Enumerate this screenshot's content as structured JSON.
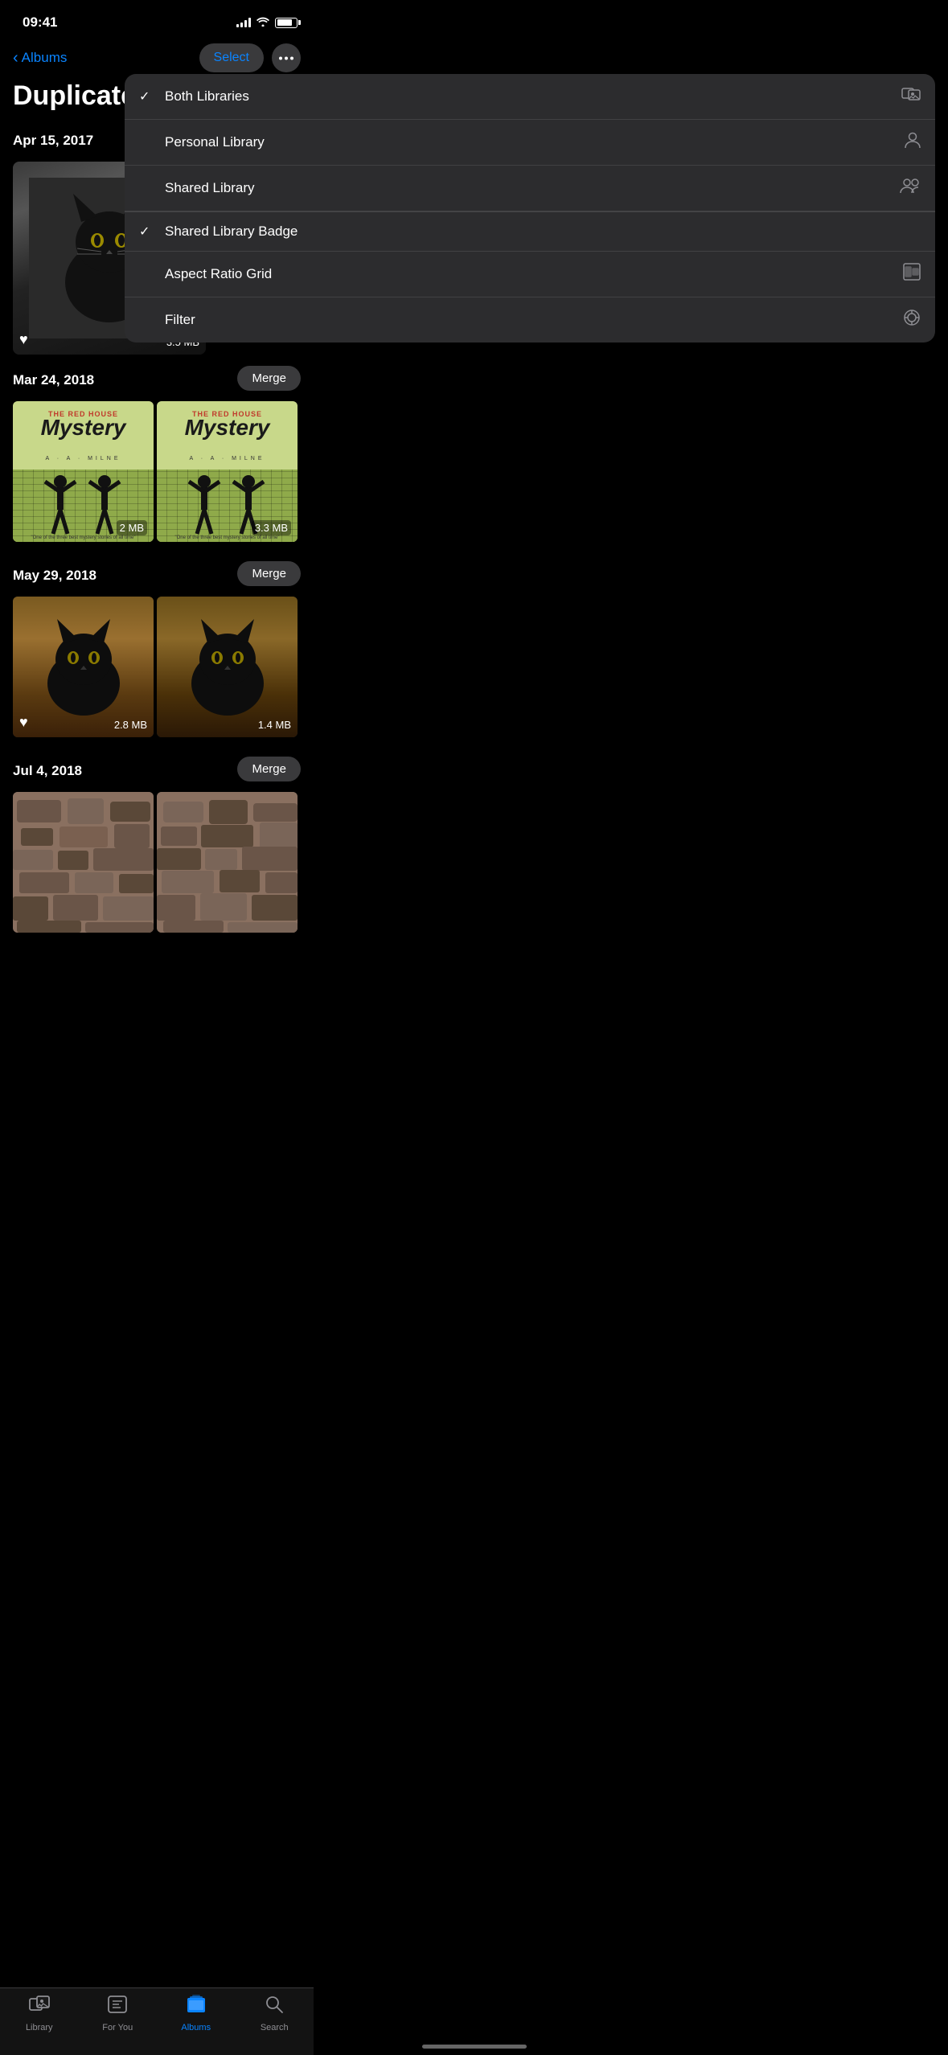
{
  "statusBar": {
    "time": "09:41"
  },
  "navBar": {
    "backLabel": "Albums",
    "selectLabel": "Select",
    "moreLabel": "•••"
  },
  "pageTitle": "Duplicates",
  "sections": [
    {
      "date": "Apr 15, 2017",
      "photos": [
        {
          "size": "3.5 MB",
          "hasHeart": true,
          "hasBadge": true,
          "type": "cat-single"
        }
      ],
      "mergeButton": null
    },
    {
      "date": "Mar 24, 2018",
      "mergeButton": "Merge",
      "photos": [
        {
          "size": "2 MB",
          "type": "book"
        },
        {
          "size": "3.3 MB",
          "type": "book"
        }
      ]
    },
    {
      "date": "May 29, 2018",
      "mergeButton": "Merge",
      "photos": [
        {
          "size": "2.8 MB",
          "hasHeart": true,
          "type": "cat-floor"
        },
        {
          "size": "1.4 MB",
          "type": "cat-floor"
        }
      ]
    },
    {
      "date": "Jul 4, 2018",
      "mergeButton": "Merge",
      "photos": [
        {
          "size": "",
          "type": "stones"
        },
        {
          "size": "",
          "type": "stones"
        }
      ]
    }
  ],
  "dropdown": {
    "items": [
      {
        "id": "both-libraries",
        "label": "Both Libraries",
        "checked": true,
        "icon": "photos-icon"
      },
      {
        "id": "personal-library",
        "label": "Personal Library",
        "checked": false,
        "icon": "person-icon"
      },
      {
        "id": "shared-library",
        "label": "Shared Library",
        "checked": false,
        "icon": "group-icon"
      },
      {
        "id": "shared-library-badge",
        "label": "Shared Library Badge",
        "checked": true,
        "icon": null
      },
      {
        "id": "aspect-ratio-grid",
        "label": "Aspect Ratio Grid",
        "checked": false,
        "icon": "grid-icon"
      },
      {
        "id": "filter",
        "label": "Filter",
        "checked": false,
        "icon": "filter-icon"
      }
    ]
  },
  "tabBar": {
    "tabs": [
      {
        "id": "library",
        "label": "Library",
        "icon": "photo-icon",
        "active": false
      },
      {
        "id": "for-you",
        "label": "For You",
        "icon": "heart-icon",
        "active": false
      },
      {
        "id": "albums",
        "label": "Albums",
        "icon": "albums-icon",
        "active": true
      },
      {
        "id": "search",
        "label": "Search",
        "icon": "search-icon",
        "active": false
      }
    ]
  }
}
